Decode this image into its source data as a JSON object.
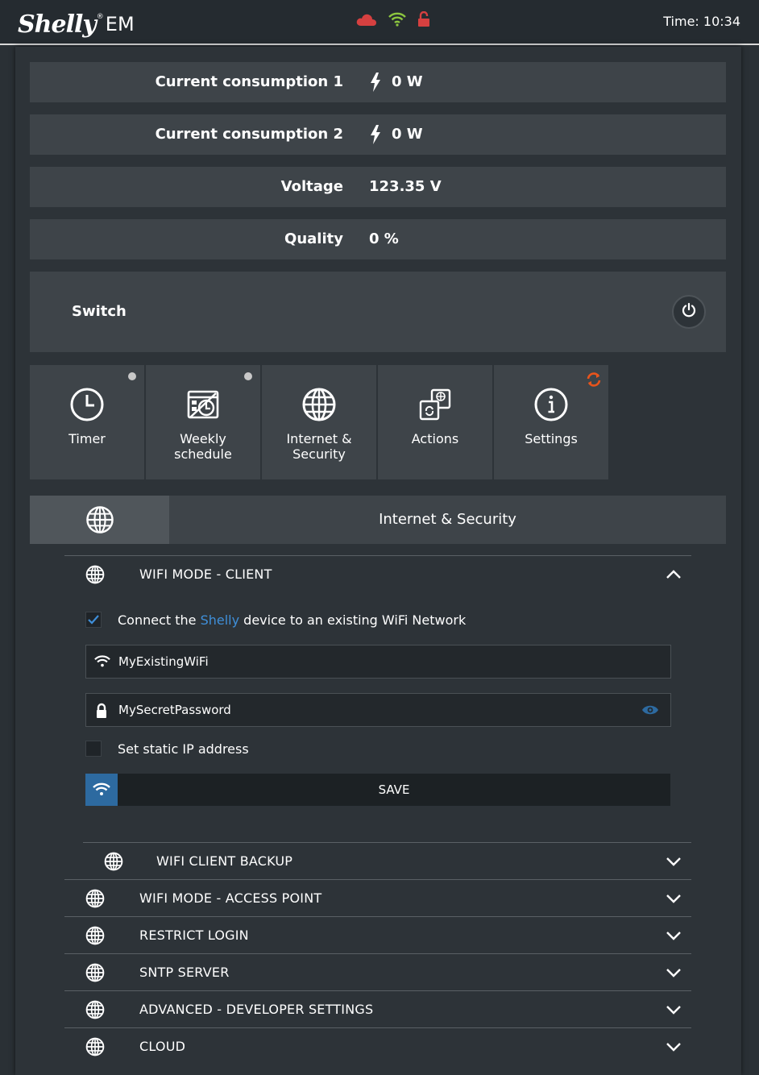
{
  "header": {
    "logo_script": "Shelly",
    "logo_suffix": "EM",
    "logo_reg": "®",
    "time": "Time: 10:34",
    "status_icons": [
      "cloud-icon",
      "wifi-icon",
      "lock-open-icon"
    ],
    "colors": {
      "cloud": "#d64040",
      "wifi": "#8cc63f",
      "lock": "#d64040"
    }
  },
  "readings": [
    {
      "label": "Current consumption 1",
      "value": "0 W",
      "icon": "bolt-icon"
    },
    {
      "label": "Current consumption 2",
      "value": "0 W",
      "icon": "bolt-icon"
    },
    {
      "label": "Voltage",
      "value": "123.35 V"
    },
    {
      "label": "Quality",
      "value": "0 %"
    }
  ],
  "switch": {
    "label": "Switch",
    "icon": "power-icon"
  },
  "tiles": [
    {
      "label": "Timer",
      "icon": "clock-icon"
    },
    {
      "label": "Weekly\nschedule",
      "icon": "calendar-icon"
    },
    {
      "label": "Internet &\nSecurity",
      "icon": "globe-icon"
    },
    {
      "label": "Actions",
      "icon": "actions-icon"
    },
    {
      "label": "Settings",
      "icon": "info-icon"
    }
  ],
  "section": {
    "title": "Internet & Security",
    "icon": "globe-icon"
  },
  "wifi_client": {
    "title": "WIFI MODE - CLIENT",
    "connect_text_pre": "Connect the ",
    "connect_text_brand": "Shelly",
    "connect_text_post": " device to an existing WiFi Network",
    "connect_checked": true,
    "ssid_value": "MyExistingWiFi",
    "password_value": "MySecretPassword",
    "static_ip_label": "Set static IP address",
    "static_ip_checked": false,
    "save_label": "SAVE",
    "accent": "#2d6aa0",
    "link_color": "#3f8fd9"
  },
  "accordions": [
    {
      "title": "WIFI CLIENT BACKUP"
    },
    {
      "title": "WIFI MODE - ACCESS POINT"
    },
    {
      "title": "RESTRICT LOGIN"
    },
    {
      "title": "SNTP SERVER"
    },
    {
      "title": "ADVANCED - DEVELOPER SETTINGS"
    },
    {
      "title": "CLOUD"
    }
  ]
}
